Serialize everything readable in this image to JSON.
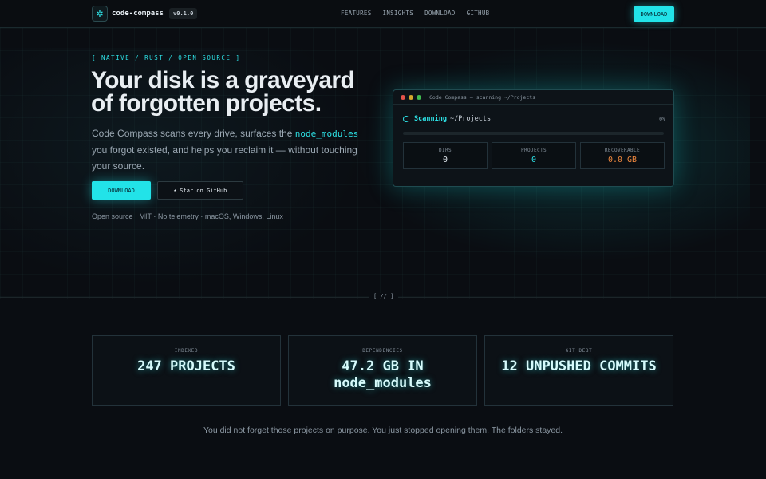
{
  "nav": {
    "brand": "code-compass",
    "version": "v0.1.0",
    "logo_icon": "compass-icon",
    "links": [
      "FEATURES",
      "INSIGHTS",
      "DOWNLOAD",
      "GITHUB"
    ],
    "download_label": "DOWNLOAD"
  },
  "hero": {
    "tagline": "[ NATIVE / RUST / OPEN SOURCE ]",
    "title": "Your disk is a graveyard of forgotten projects.",
    "desc_before": "Code Compass scans every drive, surfaces the ",
    "desc_code": "node_modules",
    "desc_after": " you forgot existed, and helps you reclaim it — without touching your source.",
    "download_label": "DOWNLOAD",
    "star_label": "Star on GitHub",
    "star_icon": "star-icon",
    "footnote": "Open source · MIT · No telemetry · macOS, Windows, Linux"
  },
  "terminal": {
    "title": "Code Compass — scanning ~/Projects",
    "scan_word": "Scanning",
    "scan_path": "~/Projects",
    "progress_label": "0%",
    "progress_fraction": 0,
    "stats": [
      {
        "label": "DIRS",
        "value": "0",
        "color": "#e6edf3"
      },
      {
        "label": "PROJECTS",
        "value": "0",
        "color": "#2de2e6"
      },
      {
        "label": "RECOVERABLE",
        "value": "0.0 GB",
        "color": "#f0883e"
      }
    ],
    "dot_colors": [
      "#e5534b",
      "#d4a72c",
      "#3fb950"
    ]
  },
  "divider": {
    "mark": "[ // ]"
  },
  "cards": [
    {
      "label": "INDEXED",
      "value": "247 PROJECTS"
    },
    {
      "label": "DEPENDENCIES",
      "value": "47.2 GB IN node_modules"
    },
    {
      "label": "GIT DEBT",
      "value": "12 UNPUSHED COMMITS"
    }
  ],
  "closing": "You did not forget those projects on purpose. You just stopped opening them. The folders stayed.",
  "colors": {
    "accent": "#22e3e8",
    "background": "#0a0d12"
  }
}
